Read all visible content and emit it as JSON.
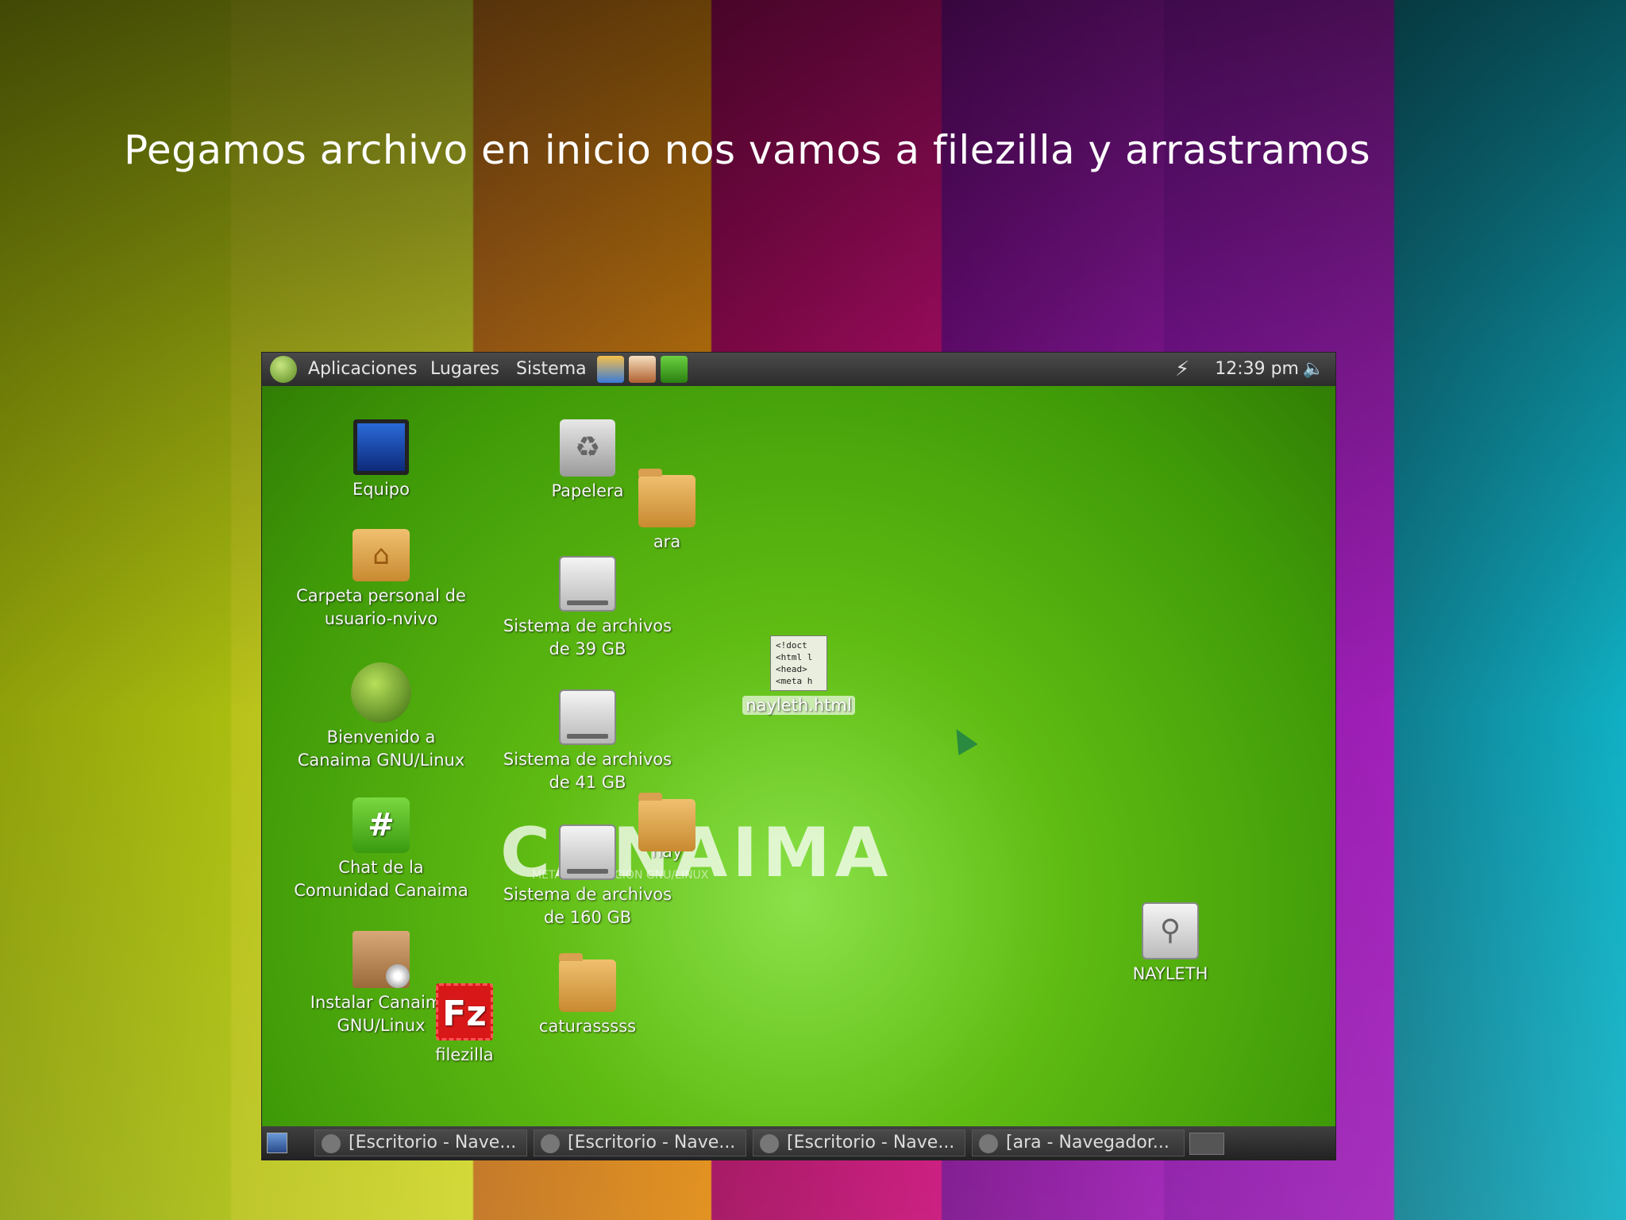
{
  "slide": {
    "title": "Pegamos archivo en inicio nos vamos a filezilla y arrastramos"
  },
  "topbar": {
    "menus": [
      "Aplicaciones",
      "Lugares",
      "Sistema"
    ],
    "clock": "12:39 pm",
    "launchers": [
      "browser-launcher-icon",
      "file-launcher-icon",
      "leaf-launcher-icon"
    ]
  },
  "desktop": {
    "icons": [
      {
        "name": "Equipo",
        "icon": "computer-icon"
      },
      {
        "name": "Papelera",
        "icon": "trash-icon"
      },
      {
        "name": "ara",
        "icon": "folder-icon"
      },
      {
        "name": "Carpeta personal de usuario-nvivo",
        "line1": "Carpeta personal de",
        "line2": "usuario-nvivo",
        "icon": "home-folder-icon"
      },
      {
        "name": "Sistema de archivos de 39 GB",
        "line1": "Sistema de archivos",
        "line2": "de 39 GB",
        "icon": "drive-icon"
      },
      {
        "name": "nayleth.html",
        "icon": "html-file-icon",
        "preview": [
          "<!doct",
          "<html l",
          "<head>",
          "<meta h"
        ]
      },
      {
        "name": "Bienvenido a Canaima GNU/Linux",
        "line1": "Bienvenido a",
        "line2": "Canaima GNU/Linux",
        "icon": "canaima-welcome-icon"
      },
      {
        "name": "Sistema de archivos de 41 GB",
        "line1": "Sistema de archivos",
        "line2": "de 41 GB",
        "icon": "drive-icon"
      },
      {
        "name": "Chat de la Comunidad Canaima",
        "line1": "Chat de la",
        "line2": "Comunidad Canaima",
        "icon": "chat-icon"
      },
      {
        "name": "nay",
        "icon": "folder-icon"
      },
      {
        "name": "Sistema de archivos de 160 GB",
        "line1": "Sistema de archivos",
        "line2": "de 160 GB",
        "icon": "drive-icon"
      },
      {
        "name": "Instalar Canaima GNU/Linux",
        "line1": "Instalar Canaima",
        "line2": "GNU/Linux",
        "icon": "installer-icon"
      },
      {
        "name": "filezilla",
        "icon": "filezilla-icon",
        "glyph": "Fz"
      },
      {
        "name": "caturasssss",
        "icon": "folder-icon"
      },
      {
        "name": "NAYLETH",
        "icon": "usb-drive-icon"
      }
    ],
    "wallpaper_logo": "CANAIMA",
    "wallpaper_sub": "METADISTRIBUCIÓN GNU/LINUX"
  },
  "taskbar": {
    "tasks": [
      "[Escritorio - Nave...",
      "[Escritorio - Nave...",
      "[Escritorio - Nave...",
      "[ara - Navegador..."
    ]
  }
}
